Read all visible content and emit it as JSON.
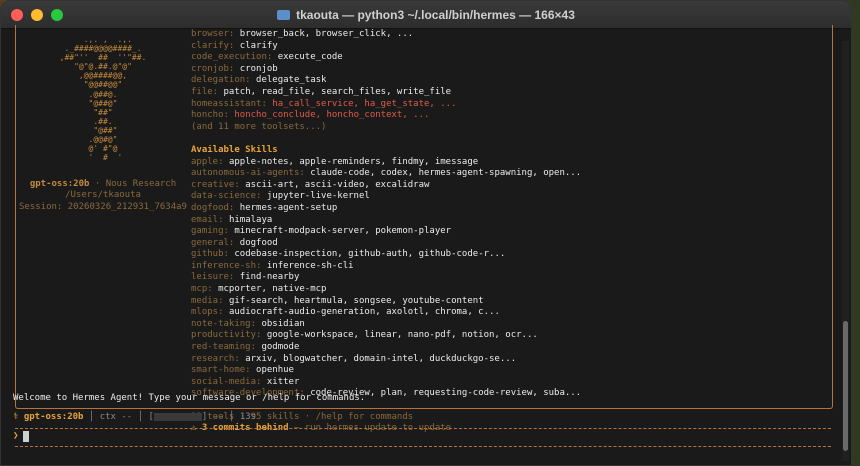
{
  "window": {
    "title": "tkaouta — python3 ~/.local/bin/hermes — 166×43"
  },
  "banner": {
    "model": "gpt-oss:20b",
    "separator": " · ",
    "provider": "Nous Research",
    "cwd": "/Users/tkaouta",
    "session": "Session: 20260326_212931_7634a9",
    "toolsets": [
      {
        "k": "browser: ",
        "v": "browser_back, browser_click, ...",
        "red": false
      },
      {
        "k": "clarify: ",
        "v": "clarify",
        "red": false
      },
      {
        "k": "code_execution: ",
        "v": "execute_code",
        "red": false
      },
      {
        "k": "cronjob: ",
        "v": "cronjob",
        "red": false
      },
      {
        "k": "delegation: ",
        "v": "delegate_task",
        "red": false
      },
      {
        "k": "file: ",
        "v": "patch, read_file, search_files, write_file",
        "red": false
      },
      {
        "k": "homeassistant: ",
        "v": "ha_call_service, ha_get_state, ...",
        "red": true
      },
      {
        "k": "honcho: ",
        "v": "honcho_conclude, honcho_context, ...",
        "red": true
      }
    ],
    "more_toolsets": "(and 11 more toolsets...)",
    "skills_heading": "Available Skills",
    "skills": [
      {
        "k": "apple: ",
        "v": "apple-notes, apple-reminders, findmy, imessage"
      },
      {
        "k": "autonomous-ai-agents: ",
        "v": "claude-code, codex, hermes-agent-spawning, open..."
      },
      {
        "k": "creative: ",
        "v": "ascii-art, ascii-video, excalidraw"
      },
      {
        "k": "data-science: ",
        "v": "jupyter-live-kernel"
      },
      {
        "k": "dogfood: ",
        "v": "hermes-agent-setup"
      },
      {
        "k": "email: ",
        "v": "himalaya"
      },
      {
        "k": "gaming: ",
        "v": "minecraft-modpack-server, pokemon-player"
      },
      {
        "k": "general: ",
        "v": "dogfood"
      },
      {
        "k": "github: ",
        "v": "codebase-inspection, github-auth, github-code-r..."
      },
      {
        "k": "inference-sh: ",
        "v": "inference-sh-cli"
      },
      {
        "k": "leisure: ",
        "v": "find-nearby"
      },
      {
        "k": "mcp: ",
        "v": "mcporter, native-mcp"
      },
      {
        "k": "media: ",
        "v": "gif-search, heartmula, songsee, youtube-content"
      },
      {
        "k": "mlops: ",
        "v": "audiocraft-audio-generation, axolotl, chroma, c..."
      },
      {
        "k": "note-taking: ",
        "v": "obsidian"
      },
      {
        "k": "productivity: ",
        "v": "google-workspace, linear, nano-pdf, notion, ocr..."
      },
      {
        "k": "red-teaming: ",
        "v": "godmode"
      },
      {
        "k": "research: ",
        "v": "arxiv, blogwatcher, domain-intel, duckduckgo-se..."
      },
      {
        "k": "smart-home: ",
        "v": "openhue"
      },
      {
        "k": "social-media: ",
        "v": "xitter"
      },
      {
        "k": "software-development: ",
        "v": "code-review, plan, requesting-code-review, suba..."
      }
    ],
    "summary": "29 tools · 95 skills · /help for commands",
    "warning_bold": "⚠ 3 commits behind",
    "warning_rest": " — run hermes update to update"
  },
  "welcome": "Welcome to Hermes Agent! Type your message or /help for commands.",
  "status": {
    "glyph": "⚕ ",
    "model": "gpt-oss:20b",
    "ctx": " │ ctx -- │ [",
    "after_bar": "] -- │ 13s"
  },
  "prompt": {
    "symbol": "❯"
  }
}
